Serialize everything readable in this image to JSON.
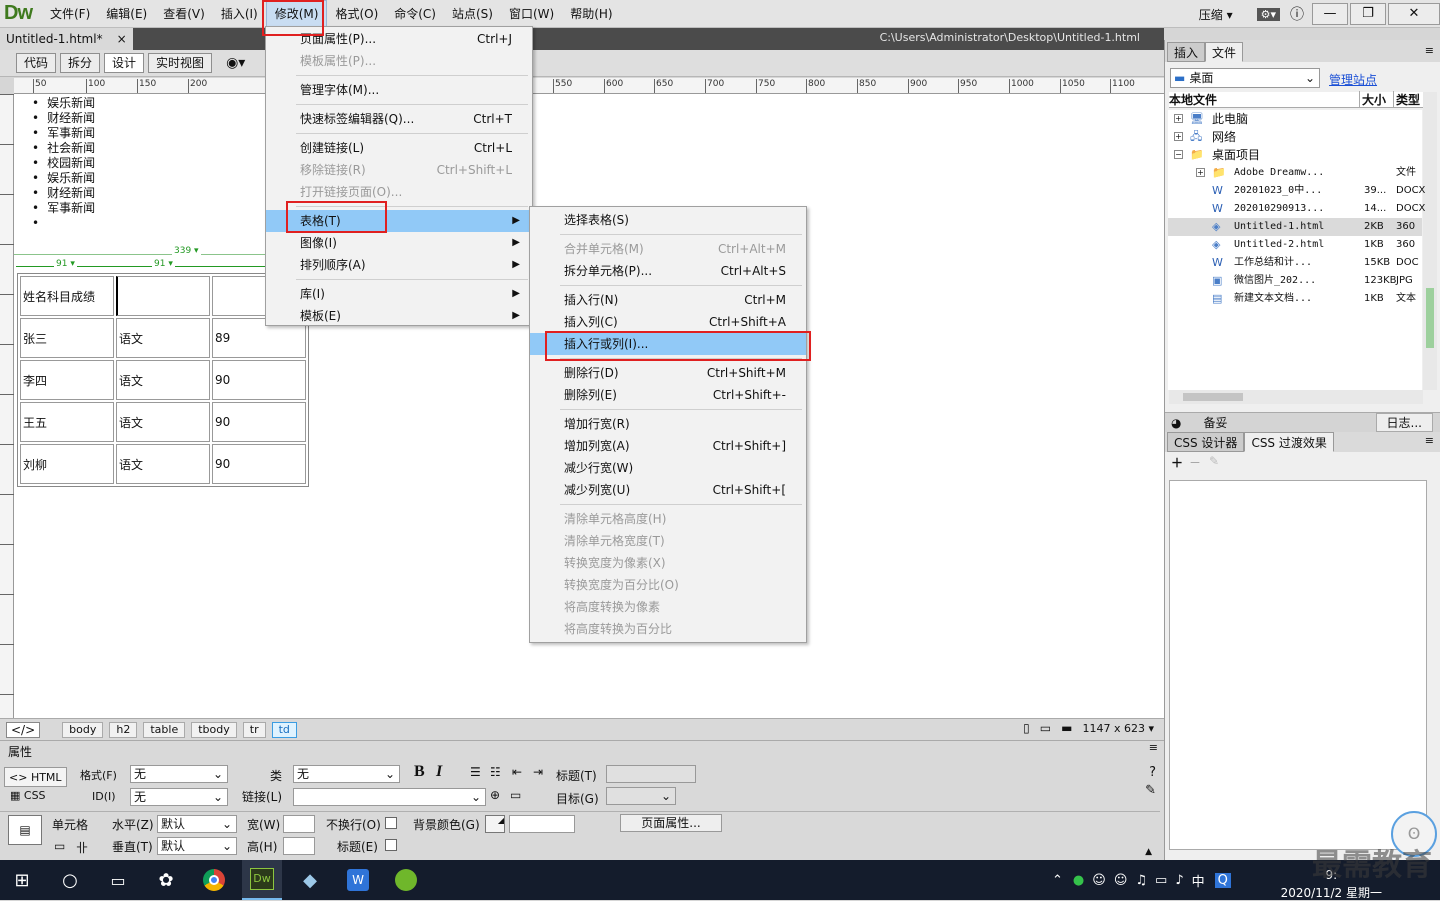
{
  "app": {
    "logo": "Dw",
    "menus": [
      "文件(F)",
      "编辑(E)",
      "查看(V)",
      "插入(I)",
      "修改(M)",
      "格式(O)",
      "命令(C)",
      "站点(S)",
      "窗口(W)",
      "帮助(H)"
    ],
    "active_menu": "修改(M)",
    "compress_label": "压缩"
  },
  "document": {
    "tab_title": "Untitled-1.html*",
    "path": "C:\\Users\\Administrator\\Desktop\\Untitled-1.html"
  },
  "viewbar": {
    "code": "代码",
    "split": "拆分",
    "design": "设计",
    "live": "实时视图"
  },
  "ruler_ticks": [
    "50",
    "100",
    "150",
    "200",
    "550",
    "600",
    "650",
    "700",
    "750",
    "800",
    "850",
    "900",
    "950",
    "1000",
    "1050",
    "1100"
  ],
  "news": [
    "娱乐新闻",
    "财经新闻",
    "军事新闻",
    "社会新闻",
    "校园新闻",
    "娱乐新闻",
    "财经新闻",
    "军事新闻",
    ""
  ],
  "table_widths": {
    "total": "339",
    "col1": "91",
    "col2": "91"
  },
  "table": [
    [
      "姓名科目成绩",
      "",
      ""
    ],
    [
      "张三",
      "语文",
      "89"
    ],
    [
      "李四",
      "语文",
      "90"
    ],
    [
      "王五",
      "语文",
      "90"
    ],
    [
      "刘柳",
      "语文",
      "90"
    ]
  ],
  "modify_menu": [
    {
      "label": "页面属性(P)...",
      "shortcut": "Ctrl+J",
      "disabled": false
    },
    {
      "label": "模板属性(P)...",
      "shortcut": "",
      "disabled": true
    },
    {
      "sep": true
    },
    {
      "label": "管理字体(M)...",
      "shortcut": "",
      "disabled": false
    },
    {
      "sep": true
    },
    {
      "label": "快速标签编辑器(Q)...",
      "shortcut": "Ctrl+T",
      "disabled": false
    },
    {
      "sep": true
    },
    {
      "label": "创建链接(L)",
      "shortcut": "Ctrl+L",
      "disabled": false
    },
    {
      "label": "移除链接(R)",
      "shortcut": "Ctrl+Shift+L",
      "disabled": true
    },
    {
      "label": "打开链接页面(O)...",
      "shortcut": "",
      "disabled": true
    },
    {
      "sep": true
    },
    {
      "label": "表格(T)",
      "shortcut": "",
      "sub": true,
      "highlight": true
    },
    {
      "label": "图像(I)",
      "shortcut": "",
      "sub": true
    },
    {
      "label": "排列顺序(A)",
      "shortcut": "",
      "sub": true
    },
    {
      "sep": true
    },
    {
      "label": "库(I)",
      "shortcut": "",
      "sub": true
    },
    {
      "label": "模板(E)",
      "shortcut": "",
      "sub": true
    }
  ],
  "table_submenu": [
    {
      "label": "选择表格(S)",
      "shortcut": "",
      "disabled": false
    },
    {
      "sep": true
    },
    {
      "label": "合并单元格(M)",
      "shortcut": "Ctrl+Alt+M",
      "disabled": true
    },
    {
      "label": "拆分单元格(P)...",
      "shortcut": "Ctrl+Alt+S",
      "disabled": false
    },
    {
      "sep": true
    },
    {
      "label": "插入行(N)",
      "shortcut": "Ctrl+M",
      "disabled": false
    },
    {
      "label": "插入列(C)",
      "shortcut": "Ctrl+Shift+A",
      "disabled": false
    },
    {
      "label": "插入行或列(I)...",
      "shortcut": "",
      "disabled": false,
      "highlight": true
    },
    {
      "sep": true
    },
    {
      "label": "删除行(D)",
      "shortcut": "Ctrl+Shift+M",
      "disabled": false
    },
    {
      "label": "删除列(E)",
      "shortcut": "Ctrl+Shift+-",
      "disabled": false
    },
    {
      "sep": true
    },
    {
      "label": "增加行宽(R)",
      "shortcut": "",
      "disabled": false
    },
    {
      "label": "增加列宽(A)",
      "shortcut": "Ctrl+Shift+]",
      "disabled": false
    },
    {
      "label": "减少行宽(W)",
      "shortcut": "",
      "disabled": false
    },
    {
      "label": "减少列宽(U)",
      "shortcut": "Ctrl+Shift+[",
      "disabled": false
    },
    {
      "sep": true
    },
    {
      "label": "清除单元格高度(H)",
      "shortcut": "",
      "disabled": true
    },
    {
      "label": "清除单元格宽度(T)",
      "shortcut": "",
      "disabled": true
    },
    {
      "label": "转换宽度为像素(X)",
      "shortcut": "",
      "disabled": true
    },
    {
      "label": "转换宽度为百分比(O)",
      "shortcut": "",
      "disabled": true
    },
    {
      "label": "将高度转换为像素",
      "shortcut": "",
      "disabled": true
    },
    {
      "label": "将高度转换为百分比",
      "shortcut": "",
      "disabled": true
    }
  ],
  "statusbar": {
    "tags": [
      "body",
      "h2",
      "table",
      "tbody",
      "tr",
      "td"
    ],
    "size": "1147 x 623"
  },
  "properties": {
    "title": "属性",
    "html": "HTML",
    "css": "CSS",
    "format_label": "格式(F)",
    "format_value": "无",
    "class_label": "类",
    "class_value": "无",
    "id_label": "ID(I)",
    "id_value": "无",
    "link_label": "链接(L)",
    "title_label": "标题(T)",
    "target_label": "目标(G)",
    "cell_label": "单元格",
    "horz_label": "水平(Z)",
    "horz_value": "默认",
    "vert_label": "垂直(T)",
    "vert_value": "默认",
    "width_label": "宽(W)",
    "height_label": "高(H)",
    "nowrap_label": "不换行(O)",
    "header_label": "标题(E)",
    "bg_label": "背景颜色(G)",
    "page_props": "页面属性..."
  },
  "rightpanel": {
    "tab_insert": "插入",
    "tab_files": "文件",
    "location": "桌面",
    "manage_sites": "管理站点",
    "col_local": "本地文件",
    "col_size": "大小",
    "col_type": "类型",
    "backup": "备妥",
    "log": "日志...",
    "css_tab1": "CSS 设计器",
    "css_tab2": "CSS 过渡效果"
  },
  "files": [
    {
      "name": "此电脑",
      "size": "",
      "type": "",
      "indent": 1,
      "icon": "pc"
    },
    {
      "name": "网络",
      "size": "",
      "type": "",
      "indent": 1,
      "icon": "net"
    },
    {
      "name": "桌面项目",
      "size": "",
      "type": "",
      "indent": 1,
      "icon": "folder"
    },
    {
      "name": "Adobe Dreamw...",
      "size": "",
      "type": "文件",
      "indent": 2,
      "icon": "folder"
    },
    {
      "name": "20201023_0中...",
      "size": "39...",
      "type": "DOCX",
      "indent": 2,
      "icon": "word"
    },
    {
      "name": "20201029091З...",
      "size": "14...",
      "type": "DOCX",
      "indent": 2,
      "icon": "word"
    },
    {
      "name": "Untitled-1.html",
      "size": "2KB",
      "type": "360",
      "indent": 2,
      "icon": "html",
      "selected": true
    },
    {
      "name": "Untitled-2.html",
      "size": "1KB",
      "type": "360",
      "indent": 2,
      "icon": "html"
    },
    {
      "name": "工作总结和计...",
      "size": "15KB",
      "type": "DOC",
      "indent": 2,
      "icon": "word"
    },
    {
      "name": "微信图片_202...",
      "size": "123KB",
      "type": "JPG",
      "indent": 2,
      "icon": "img"
    },
    {
      "name": "新建文本文档...",
      "size": "1KB",
      "type": "文本",
      "indent": 2,
      "icon": "txt"
    }
  ],
  "taskbar": {
    "time": "9:",
    "date": "2020/11/2 星期一",
    "ime": "中"
  },
  "watermark": "最需教育"
}
